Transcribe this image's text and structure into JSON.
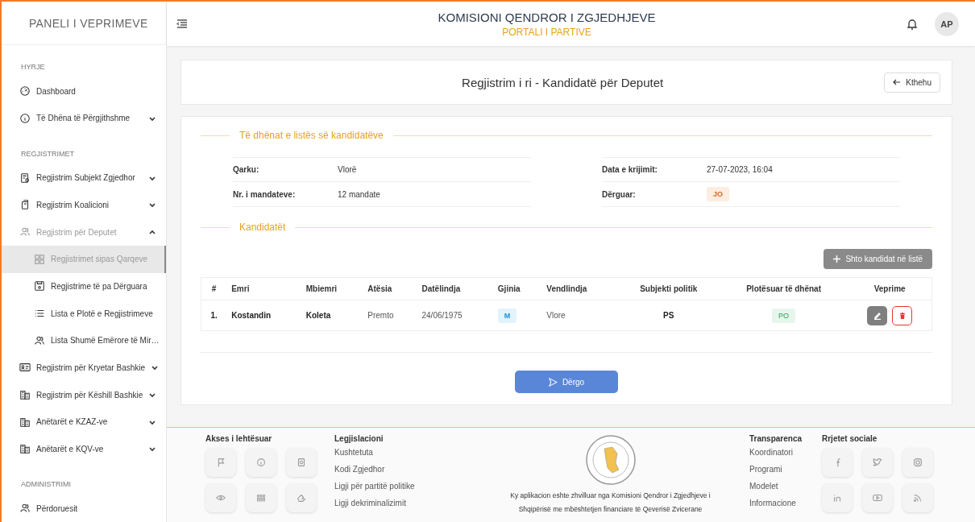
{
  "brand": "PANELI I VEPRIMEVE",
  "header": {
    "title": "KOMISIONI QENDROR I ZGJEDHJEVE",
    "subtitle": "PORTALI I PARTIVE",
    "avatar": "AP"
  },
  "sidebar": {
    "sections": [
      {
        "heading": "HYRJE",
        "items": [
          {
            "label": "Dashboard",
            "selected": false
          },
          {
            "label": "Të Dhëna të Përgjithshme",
            "selected": false,
            "expanded": false
          }
        ]
      },
      {
        "heading": "REGJISTRIMET",
        "items": [
          {
            "label": "Regjistrim Subjekt Zgjedhor",
            "selected": false,
            "expanded": false
          },
          {
            "label": "Regjistrim Koalicioni",
            "selected": false,
            "expanded": false
          },
          {
            "label": "Regjistrim për Deputet",
            "selected": true,
            "expanded": true,
            "children": [
              {
                "label": "Regjistrimet sipas Qarqeve",
                "selected": true
              },
              {
                "label": "Regjistrime të pa Dërguara",
                "selected": false
              },
              {
                "label": "Lista e Plotë e Regjistrimeve",
                "selected": false
              },
              {
                "label": "Lista Shumë Emërore të Mir…",
                "selected": false
              }
            ]
          },
          {
            "label": "Regjistrim për Kryetar Bashkie",
            "selected": false,
            "expanded": false
          },
          {
            "label": "Regjistrim për Këshill Bashkie",
            "selected": false,
            "expanded": false
          },
          {
            "label": "Anëtarët e KZAZ-ve",
            "selected": false,
            "expanded": false
          },
          {
            "label": "Anëtarët e KQV-ve",
            "selected": false,
            "expanded": false
          }
        ]
      },
      {
        "heading": "ADMINISTRIMI",
        "items": [
          {
            "label": "Përdoruesit",
            "selected": false
          }
        ]
      }
    ]
  },
  "page": {
    "title": "Regjistrim i ri - Kandidatë për Deputet",
    "back_button": "Kthehu"
  },
  "list_info": {
    "legend": "Të dhënat e listës së kandidatëve",
    "left": [
      {
        "label": "Qarku:",
        "value": "Vlorë",
        "kind": "text"
      },
      {
        "label": "Nr. i mandateve:",
        "value": "12 mandate",
        "kind": "text"
      }
    ],
    "right": [
      {
        "label": "Data e krijimit:",
        "value": "27-07-2023, 16:04",
        "kind": "text"
      },
      {
        "label": "Dërguar:",
        "value": "JO",
        "kind": "badge"
      }
    ]
  },
  "candidates": {
    "legend": "Kandidatët",
    "add_button": "Shto kandidat në listë",
    "columns": [
      "#",
      "Emri",
      "Mbiemri",
      "Atësia",
      "Datëlindja",
      "Gjinia",
      "Vendlindja",
      "Subjekti politik",
      "Plotësuar të dhënat",
      "Veprime"
    ],
    "rows": [
      {
        "number": "1.",
        "name": "Kostandin",
        "surname": "Koleta",
        "father": "Premto",
        "birth_date": "24/06/1975",
        "gender": "M",
        "birthplace": "Vlore",
        "party": "PS",
        "complete": "PO"
      }
    ]
  },
  "send_button": "Dërgo",
  "footer": {
    "accessibility": {
      "heading": "Akses i lehtësuar"
    },
    "legislation": {
      "heading": "Legjislacioni",
      "links": [
        "Kushtetuta",
        "Kodi Zgjedhor",
        "Ligji për partitë politike",
        "Ligji dekriminalizimit"
      ]
    },
    "note": "Ky aplikacion eshte zhvilluar nga Komisioni Qendror i Zgjedhjeve i Shqipërisë me mbështetjen financiare të Qeverisë Zvicerane",
    "transparency": {
      "heading": "Transparenca",
      "links": [
        "Koordinatori",
        "Programi",
        "Modelet",
        "Informacione"
      ]
    },
    "social": {
      "heading": "Rrjetet sociale"
    }
  }
}
